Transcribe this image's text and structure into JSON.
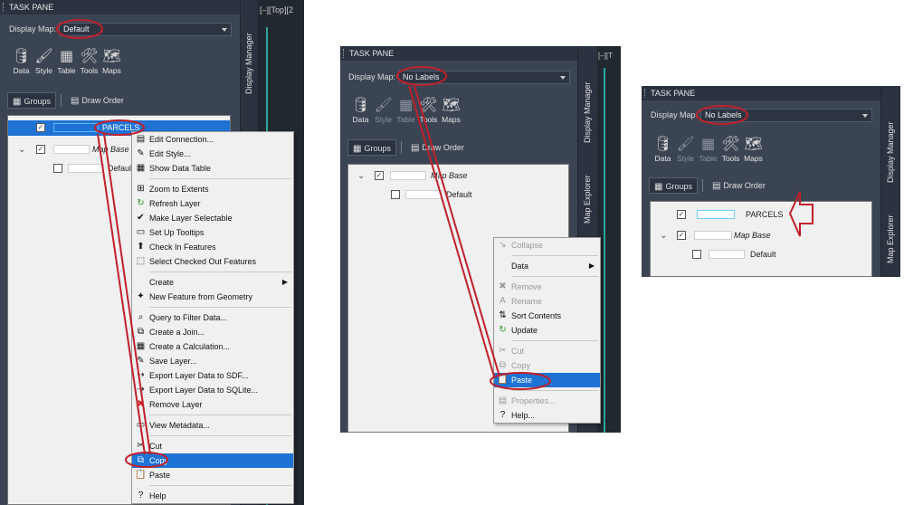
{
  "pane1": {
    "title": "TASK PANE",
    "display_map_label": "Display Map:",
    "display_map_value": "Default",
    "tools": [
      {
        "label": "Data",
        "icon": "database-icon",
        "glyph": "🛢"
      },
      {
        "label": "Style",
        "icon": "brush-icon",
        "glyph": "🖌"
      },
      {
        "label": "Table",
        "icon": "table-icon",
        "glyph": "▦"
      },
      {
        "label": "Tools",
        "icon": "tools-icon",
        "glyph": "🛠"
      },
      {
        "label": "Maps",
        "icon": "maps-icon",
        "glyph": "🗺"
      }
    ],
    "tabs": {
      "groups": "Groups",
      "draw_order": "Draw Order"
    },
    "tree": {
      "parcels": "PARCELS",
      "map_base": "Map Base",
      "default": "Default"
    },
    "side_tab": "Display Manager",
    "viewport_label": "[–][Top][2"
  },
  "context_menu": {
    "items": [
      {
        "label": "Edit Connection...",
        "icon": "database-edit-icon",
        "glyph": "▤"
      },
      {
        "label": "Edit Style...",
        "icon": "brush-icon",
        "glyph": "✎"
      },
      {
        "label": "Show Data Table",
        "icon": "table-icon",
        "glyph": "▦"
      },
      {
        "sep": true
      },
      {
        "label": "Zoom to Extents",
        "icon": "zoom-extents-icon",
        "glyph": "⊞"
      },
      {
        "label": "Refresh Layer",
        "icon": "refresh-icon",
        "glyph": "↻"
      },
      {
        "label": "Make Layer Selectable",
        "icon": "check-icon",
        "glyph": "✔"
      },
      {
        "label": "Set Up Tooltips",
        "icon": "tooltip-icon",
        "glyph": "▭"
      },
      {
        "label": "Check In Features",
        "icon": "check-in-icon",
        "glyph": "⬆"
      },
      {
        "label": "Select Checked Out Features",
        "icon": "select-checked-out-icon",
        "glyph": "⬚"
      },
      {
        "sep": true
      },
      {
        "label": "Create",
        "icon": "",
        "glyph": "",
        "submenu": true
      },
      {
        "label": "New Feature from Geometry",
        "icon": "new-feature-icon",
        "glyph": "✦"
      },
      {
        "sep": true
      },
      {
        "label": "Query to Filter Data...",
        "icon": "query-icon",
        "glyph": "⌕"
      },
      {
        "label": "Create a Join...",
        "icon": "join-icon",
        "glyph": "⧉"
      },
      {
        "label": "Create a Calculation...",
        "icon": "calculator-icon",
        "glyph": "▦"
      },
      {
        "label": "Save Layer...",
        "icon": "save-layer-icon",
        "glyph": "✎"
      },
      {
        "label": "Export Layer Data to SDF...",
        "icon": "export-sdf-icon",
        "glyph": "⇢"
      },
      {
        "label": "Export Layer Data to SQLite...",
        "icon": "export-sqlite-icon",
        "glyph": "⇢"
      },
      {
        "label": "Remove Layer",
        "icon": "remove-icon",
        "glyph": "✖"
      },
      {
        "sep": true
      },
      {
        "label": "View Metadata...",
        "icon": "metadata-icon",
        "glyph": "▭"
      },
      {
        "sep": true
      },
      {
        "label": "Cut",
        "icon": "cut-icon",
        "glyph": "✂"
      },
      {
        "label": "Copy",
        "icon": "copy-icon",
        "glyph": "⧉",
        "highlighted": true
      },
      {
        "label": "Paste",
        "icon": "paste-icon",
        "glyph": "📋"
      },
      {
        "sep": true
      },
      {
        "label": "Help",
        "icon": "help-icon",
        "glyph": "?"
      }
    ]
  },
  "pane2": {
    "title": "TASK PANE",
    "display_map_label": "Display Map:",
    "display_map_value": "No Labels",
    "tools": [
      {
        "label": "Data",
        "icon": "database-icon",
        "glyph": "🛢",
        "dim": false
      },
      {
        "label": "Style",
        "icon": "brush-icon",
        "glyph": "🖌",
        "dim": true
      },
      {
        "label": "Table",
        "icon": "table-icon",
        "glyph": "▦",
        "dim": true
      },
      {
        "label": "Tools",
        "icon": "tools-icon",
        "glyph": "🛠",
        "dim": false
      },
      {
        "label": "Maps",
        "icon": "maps-icon",
        "glyph": "🗺",
        "dim": false
      }
    ],
    "tabs": {
      "groups": "Groups",
      "draw_order": "Draw Order"
    },
    "tree": {
      "map_base": "Map Base",
      "default": "Default"
    },
    "side_tabs": [
      "Display Manager",
      "Map Explorer"
    ],
    "viewport_label": "[–][T"
  },
  "context_menu2": {
    "items": [
      {
        "label": "Collapse",
        "icon": "collapse-icon",
        "glyph": "↘",
        "disabled": true
      },
      {
        "sep": true
      },
      {
        "label": "Data",
        "icon": "",
        "glyph": "",
        "submenu": true
      },
      {
        "sep": true
      },
      {
        "label": "Remove",
        "icon": "remove-icon",
        "glyph": "✖",
        "disabled": true
      },
      {
        "label": "Rename",
        "icon": "rename-icon",
        "glyph": "A",
        "disabled": true
      },
      {
        "label": "Sort Contents",
        "icon": "sort-icon",
        "glyph": "⇅"
      },
      {
        "label": "Update",
        "icon": "refresh-icon",
        "glyph": "↻"
      },
      {
        "sep": true
      },
      {
        "label": "Cut",
        "icon": "cut-icon",
        "glyph": "✂",
        "disabled": true
      },
      {
        "label": "Copy",
        "icon": "copy-icon",
        "glyph": "⧉",
        "disabled": true
      },
      {
        "label": "Paste",
        "icon": "paste-icon",
        "glyph": "📋",
        "highlighted": true
      },
      {
        "sep": true
      },
      {
        "label": "Properties...",
        "icon": "properties-icon",
        "glyph": "▤",
        "disabled": true
      },
      {
        "label": "Help...",
        "icon": "help-icon",
        "glyph": "?"
      }
    ]
  },
  "pane3": {
    "title": "TASK PANE",
    "display_map_label": "Display Map:",
    "display_map_value": "No Labels",
    "tools": [
      {
        "label": "Data",
        "icon": "database-icon",
        "glyph": "🛢",
        "dim": false
      },
      {
        "label": "Style",
        "icon": "brush-icon",
        "glyph": "🖌",
        "dim": true
      },
      {
        "label": "Table",
        "icon": "table-icon",
        "glyph": "▦",
        "dim": true
      },
      {
        "label": "Tools",
        "icon": "tools-icon",
        "glyph": "🛠",
        "dim": false
      },
      {
        "label": "Maps",
        "icon": "maps-icon",
        "glyph": "🗺",
        "dim": false
      }
    ],
    "tabs": {
      "groups": "Groups",
      "draw_order": "Draw Order"
    },
    "tree": {
      "parcels": "PARCELS",
      "map_base": "Map Base",
      "default": "Default"
    },
    "side_tabs": [
      "Display Manager",
      "Map Explorer"
    ]
  },
  "colors": {
    "annotation_red": "#c0202a",
    "selection_blue": "#1e73d4",
    "pane_bg": "#3b4453"
  }
}
